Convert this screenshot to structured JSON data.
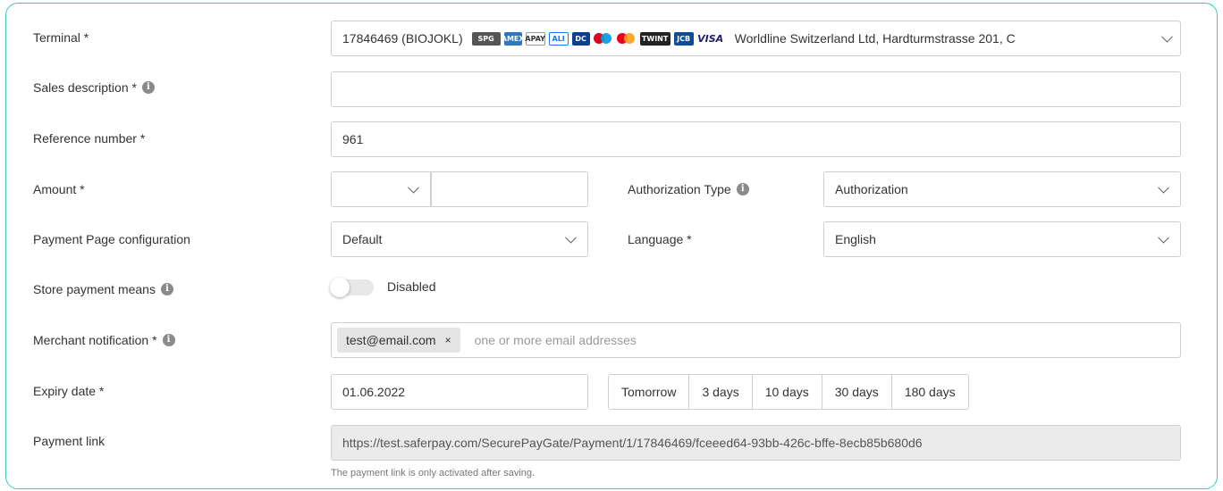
{
  "terminal": {
    "label": "Terminal *",
    "value": "17846469 (BIOJOKL)",
    "payment_methods": [
      "SPG",
      "AMEX",
      "APAY",
      "ALI",
      "DC",
      "",
      "",
      "TWINT",
      "JCB",
      "VISA"
    ],
    "address": "Worldline Switzerland Ltd, Hardturmstrasse 201, C"
  },
  "sales_description": {
    "label": "Sales description *",
    "value": ""
  },
  "reference_number": {
    "label": "Reference number *",
    "value": "961"
  },
  "amount": {
    "label": "Amount *",
    "currency": "",
    "value": ""
  },
  "authorization_type": {
    "label": "Authorization Type",
    "value": "Authorization"
  },
  "payment_page_config": {
    "label": "Payment Page configuration",
    "value": "Default"
  },
  "language": {
    "label": "Language *",
    "value": "English"
  },
  "store_payment_means": {
    "label": "Store payment means",
    "state": "Disabled"
  },
  "merchant_notification": {
    "label": "Merchant notification *",
    "chip": "test@email.com",
    "chip_remove": "×",
    "placeholder": "one or more email addresses"
  },
  "expiry_date": {
    "label": "Expiry date *",
    "value": "01.06.2022",
    "quick_options": [
      "Tomorrow",
      "3 days",
      "10 days",
      "30 days",
      "180 days"
    ]
  },
  "payment_link": {
    "label": "Payment link",
    "value": "https://test.saferpay.com/SecurePayGate/Payment/1/17846469/fceeed64-93bb-426c-bffe-8ecb85b680d6",
    "hint": "The payment link is only activated after saving."
  },
  "colors": {
    "accent_border": "#3ec7c2",
    "input_border": "#cfcfcf",
    "disabled_bg": "#ebebeb"
  },
  "icons": {
    "info": "info-icon",
    "dropdown": "chevron-down-icon",
    "remove": "close-icon"
  }
}
